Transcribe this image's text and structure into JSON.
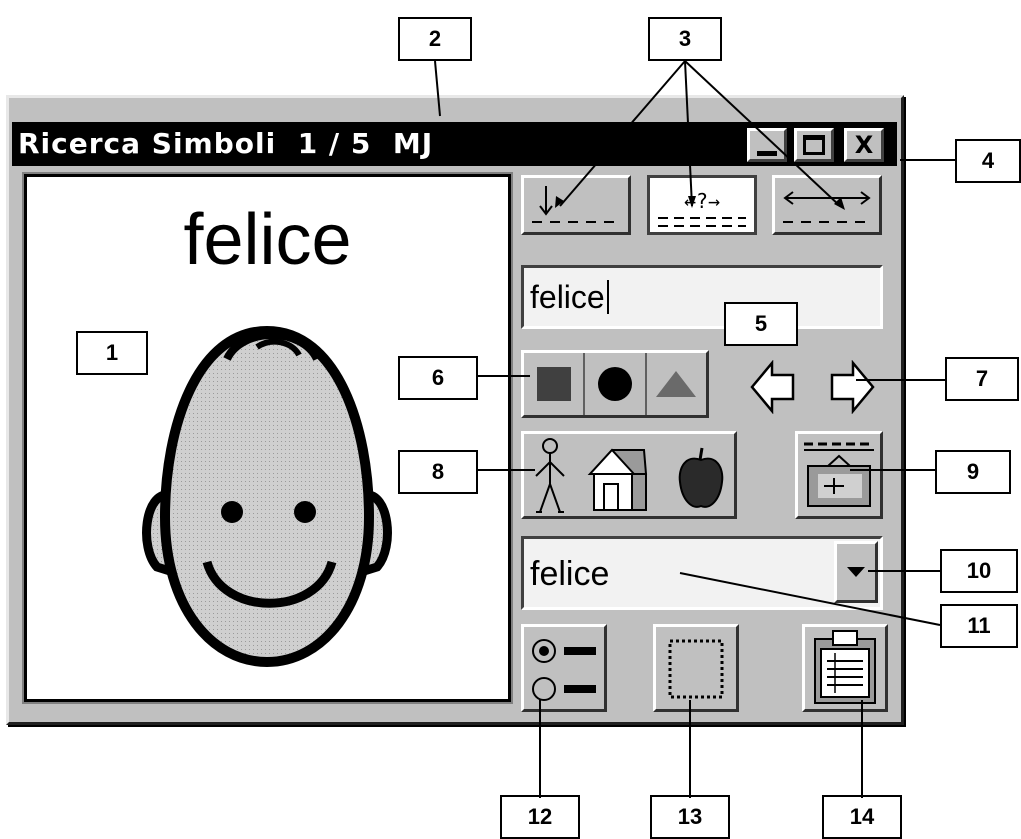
{
  "window": {
    "title": "Ricerca Simboli  1 / 5  MJ",
    "minimize_label": "_",
    "maximize_label": "□",
    "close_label": "X"
  },
  "preview": {
    "word": "felice",
    "symbol_icon": "smiling-face-icon"
  },
  "search_mode_buttons": [
    {
      "icon": "starts-with-icon",
      "glyph": "↓"
    },
    {
      "icon": "contains-icon",
      "glyph": "←?→"
    },
    {
      "icon": "whole-word-icon",
      "glyph": "⟵⟶"
    }
  ],
  "search_field": {
    "value": "felice"
  },
  "shape_buttons": [
    {
      "icon": "square-icon"
    },
    {
      "icon": "circle-icon"
    },
    {
      "icon": "triangle-icon"
    }
  ],
  "nav_arrows": [
    {
      "icon": "arrow-left-icon"
    },
    {
      "icon": "arrow-right-icon"
    }
  ],
  "category_icons": [
    "person-icon",
    "house-icon",
    "apple-icon"
  ],
  "result_combo": {
    "value": "felice",
    "dropdown_icon": "chevron-down-icon"
  },
  "bottom_buttons": [
    "radio-options-icon",
    "frame-icon",
    "clipboard-icon"
  ],
  "callouts": [
    "1",
    "2",
    "3",
    "4",
    "5",
    "6",
    "7",
    "8",
    "9",
    "10",
    "11",
    "12",
    "13",
    "14"
  ],
  "colors": {
    "window_gray": "#c0c0c0",
    "titlebar": "#000000",
    "shape_fill": "#404040",
    "triangle_fill": "#6a6a6a",
    "face_fill": "#c8c8c8"
  }
}
